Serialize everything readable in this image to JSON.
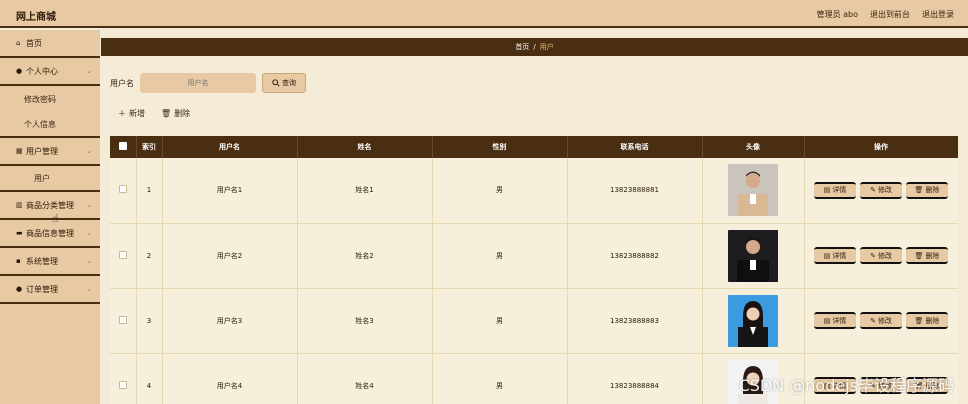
{
  "app": {
    "title": "网上商城",
    "admin_label": "管理员 abo",
    "front_link": "退出到前台",
    "logout_link": "退出登录"
  },
  "sidebar": {
    "items": [
      {
        "label": "首页",
        "icon": "home-icon"
      },
      {
        "label": "个人中心",
        "icon": "user-icon"
      },
      {
        "label": "修改密码",
        "icon": ""
      },
      {
        "label": "个人信息",
        "icon": ""
      },
      {
        "label": "用户管理",
        "icon": "grid-icon"
      },
      {
        "label": "用户",
        "icon": ""
      },
      {
        "label": "商品分类管理",
        "icon": "chart-icon"
      },
      {
        "label": "商品信息管理",
        "icon": "card-icon"
      },
      {
        "label": "系统管理",
        "icon": "apps-icon"
      },
      {
        "label": "订单管理",
        "icon": "user-icon"
      }
    ]
  },
  "breadcrumb": {
    "home": "首页",
    "sep": "/",
    "current": "用户"
  },
  "search": {
    "label": "用户名",
    "placeholder": "用户名",
    "button": "查询"
  },
  "actions": {
    "add": "新增",
    "delete": "删除"
  },
  "table": {
    "headers": [
      "",
      "索引",
      "用户名",
      "姓名",
      "性别",
      "联系电话",
      "头像",
      "操作"
    ],
    "rows": [
      {
        "index": "1",
        "username": "用户名1",
        "name": "姓名1",
        "gender": "男",
        "phone": "13823888881"
      },
      {
        "index": "2",
        "username": "用户名2",
        "name": "姓名2",
        "gender": "男",
        "phone": "13823888882"
      },
      {
        "index": "3",
        "username": "用户名3",
        "name": "姓名3",
        "gender": "男",
        "phone": "13823888883"
      },
      {
        "index": "4",
        "username": "用户名4",
        "name": "姓名4",
        "gender": "男",
        "phone": "13823888884"
      }
    ],
    "ops": {
      "detail": "详情",
      "edit": "修改",
      "delete": "删除"
    }
  },
  "watermark": "CSDN @nodejs毕设程序源码",
  "colors": {
    "header_bg": "#e7c9a3",
    "accent_dark": "#4a2e12",
    "content_bg": "#f4ecd6",
    "crumb_current": "#e8b86b"
  }
}
